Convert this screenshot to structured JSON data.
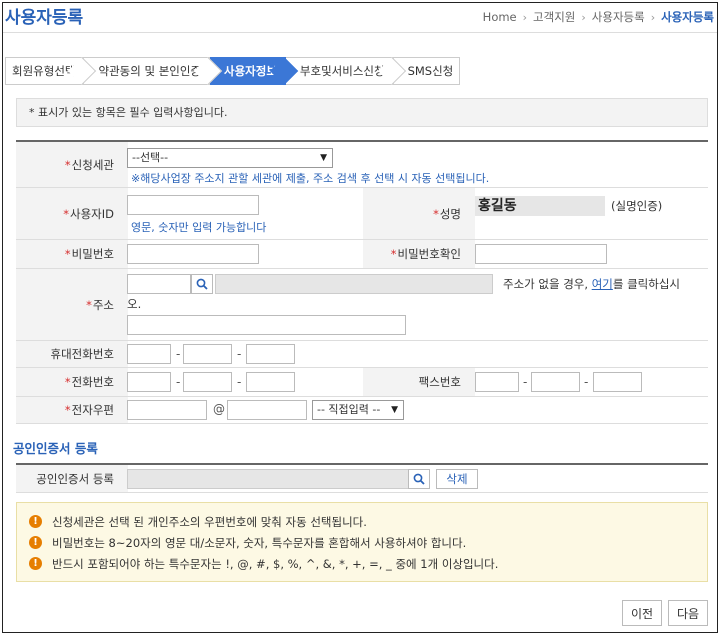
{
  "header": {
    "title": "사용자등록",
    "breadcrumb": [
      "Home",
      "고객지원",
      "사용자등록",
      "사용자등록"
    ]
  },
  "steps": [
    "회원유형선택",
    "약관동의 및 본인인증",
    "사용자정보",
    "부호및서비스신청",
    "SMS신청"
  ],
  "active_step": 2,
  "notice": "* 표시가 있는 항목은 필수 입력사항입니다.",
  "form": {
    "office": {
      "label": "신청세관",
      "select_value": "--선택--",
      "hint": "※해당사업장 주소지 관할 세관에 제출, 주소 검색 후 선택 시 자동 선택됩니다."
    },
    "user_id": {
      "label": "사용자ID",
      "value": "",
      "hint": "영문, 숫자만 입력 가능합니다"
    },
    "name": {
      "label": "성명",
      "value": "홍길동",
      "note": "(실명인증)"
    },
    "password": {
      "label": "비밀번호",
      "value": ""
    },
    "password_confirm": {
      "label": "비밀번호확인",
      "value": ""
    },
    "address": {
      "label": "주소",
      "zip": "",
      "addr1": "",
      "addr2": "",
      "note_before": "주소가 없을 경우,",
      "note_link": "여기",
      "note_after": "를 클릭하십시",
      "note_wrap": "오."
    },
    "mobile": {
      "label": "휴대전화번호",
      "parts": [
        "",
        "",
        ""
      ]
    },
    "phone": {
      "label": "전화번호",
      "parts": [
        "",
        "",
        ""
      ]
    },
    "fax": {
      "label": "팩스번호",
      "parts": [
        "",
        "",
        ""
      ]
    },
    "email": {
      "label": "전자우편",
      "local": "",
      "at": "@",
      "domain": "",
      "domain_select": "-- 직접입력 --"
    }
  },
  "required_mark": "*",
  "dash": "-",
  "cert": {
    "section_title": "공인인증서 등록",
    "label": "공인인증서 등록",
    "value": "",
    "delete_button": "삭제"
  },
  "warnings": [
    "신청세관은 선택 된 개인주소의 우편번호에 맞춰 자동 선택됩니다.",
    "비밀번호는 8~20자의 영문 대/소문자, 숫자, 특수문자를 혼합해서 사용하셔야 합니다.",
    "반드시 포함되어야 하는 특수문자는 !, @, #, $, %, ^, &, *, +, =, _ 중에 1개 이상입니다."
  ],
  "warning_icon": "!",
  "buttons": {
    "prev": "이전",
    "next": "다음"
  },
  "colors": {
    "accent": "#2a62b7",
    "active_tab": "#3b77d6",
    "required": "#d62c2c",
    "warning_icon": "#e67e00"
  }
}
